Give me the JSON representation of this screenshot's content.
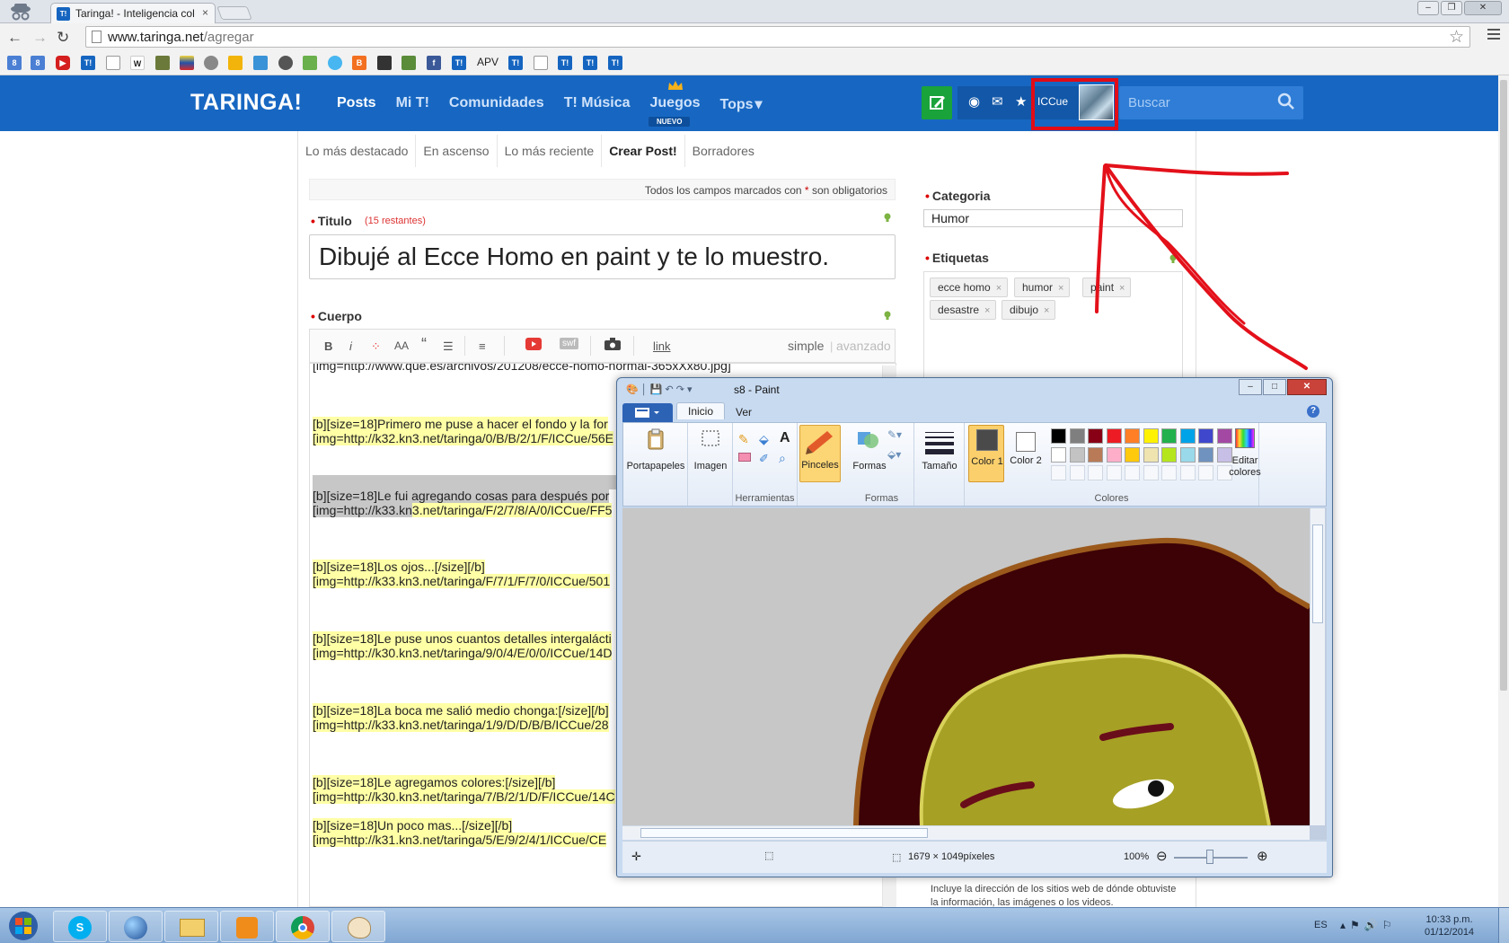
{
  "browser": {
    "tab_title": "Taringa! - Inteligencia col",
    "tab_close": "×",
    "favicon_text": "T!",
    "url_host": "www.taringa.net",
    "url_path": "/agregar",
    "bookmark_label": "APV"
  },
  "header": {
    "logo": "TARINGA!",
    "nav": [
      "Posts",
      "Mi T!",
      "Comunidades",
      "T! Música",
      "Juegos",
      "Tops"
    ],
    "nuevo_badge": "NUEVO",
    "username": "ICCue",
    "search_placeholder": "Buscar"
  },
  "subnav": [
    "Lo más destacado",
    "En ascenso",
    "Lo más reciente",
    "Crear Post!",
    "Borradores"
  ],
  "form": {
    "required_note_pre": "Todos los campos marcados con",
    "required_note_ast": "*",
    "required_note_post": "son obligatorios",
    "titulo_label": "Titulo",
    "titulo_remaining": "(15 restantes)",
    "titulo_value": "Dibujé al Ecce Homo en paint y te lo muestro.",
    "cuerpo_label": "Cuerpo",
    "toolbar": {
      "bold": "B",
      "italic": "i",
      "size": "AA",
      "quote": "“",
      "swf": "swf",
      "link": "link",
      "simple": "simple",
      "avanzado": "avanzado"
    },
    "body_lines": [
      {
        "pre": "[img=http://www.que.es/archivos/201208/ecce-homo-normal-365xXx80.jpg]",
        "hl": "",
        "sel": ""
      },
      {
        "pre": "",
        "hl": "[b][size=18]Primero me puse a hacer el fondo y la for",
        "sel": ""
      },
      {
        "pre": "",
        "hl": "[img=http://k32.kn3.net/taringa/0/B/B/2/1/F/ICCue/56E",
        "sel": ""
      },
      {
        "pre": "",
        "hl": "",
        "sel": "[b][size=18]Le fui agregando cosas para después por"
      },
      {
        "pre": "",
        "hl": "3.net/taringa/F/2/7/8/A/0/ICCue/FF5",
        "sel": "[img=http://k33.kn"
      },
      {
        "pre": "",
        "hl": "[b][size=18]Los ojos...[/size][/b]",
        "sel": ""
      },
      {
        "pre": "",
        "hl": "[img=http://k33.kn3.net/taringa/F/7/1/F/7/0/ICCue/501",
        "sel": ""
      },
      {
        "pre": "",
        "hl": "[b][size=18]Le puse unos cuantos detalles intergalácti",
        "sel": ""
      },
      {
        "pre": "",
        "hl": "[img=http://k30.kn3.net/taringa/9/0/4/E/0/0/ICCue/14D",
        "sel": ""
      },
      {
        "pre": "",
        "hl": "[b][size=18]La boca me salió medio chonga:[/size][/b]",
        "sel": ""
      },
      {
        "pre": "",
        "hl": "[img=http://k33.kn3.net/taringa/1/9/D/D/B/B/ICCue/28",
        "sel": ""
      },
      {
        "pre": "",
        "hl": "[b][size=18]Le agregamos colores:[/size][/b]",
        "sel": ""
      },
      {
        "pre": "",
        "hl": "[img=http://k30.kn3.net/taringa/7/B/2/1/D/F/ICCue/14C",
        "sel": ""
      },
      {
        "pre": "",
        "hl": "[b][size=18]Un poco mas...[/size][/b]",
        "sel": ""
      },
      {
        "pre": "",
        "hl": "[img=http://k31.kn3.net/taringa/5/E/9/2/4/1/ICCue/CE",
        "sel": ""
      }
    ],
    "categoria_label": "Categoria",
    "categoria_value": "Humor",
    "etiquetas_label": "Etiquetas",
    "tags": [
      "ecce homo",
      "humor",
      "paint",
      "desastre",
      "dibujo"
    ],
    "tag_remove": "×",
    "help_text": "Incluye la dirección de los sitios web de dónde obtuviste la información, las imágenes o los videos."
  },
  "paint": {
    "title": "s8 - Paint",
    "tabs": [
      "Inicio",
      "Ver"
    ],
    "groups": {
      "portapapeles": "Portapapeles",
      "imagen": "Imagen",
      "herramientas": "Herramientas",
      "pinceles": "Pinceles",
      "formas_btn": "Formas",
      "formas_group": "Formas",
      "tamano": "Tamaño",
      "color1": "Color 1",
      "color2": "Color 2",
      "colores": "Colores",
      "editar_colores": "Editar colores"
    },
    "palette_row1": [
      "#000000",
      "#7f7f7f",
      "#880015",
      "#ed1c24",
      "#ff7f27",
      "#fff200",
      "#22b14c",
      "#00a2e8",
      "#3f48cc",
      "#a349a4"
    ],
    "palette_row2": [
      "#ffffff",
      "#c3c3c3",
      "#b97a57",
      "#ffaec9",
      "#ffc90e",
      "#efe4b0",
      "#b5e61d",
      "#99d9ea",
      "#7092be",
      "#c8bfe7"
    ],
    "color1_hex": "#4a4a4a",
    "dimensions": "1679 × 1049píxeles",
    "zoom": "100%"
  },
  "taskbar": {
    "lang": "ES",
    "time": "10:33 p.m.",
    "date": "01/12/2014"
  }
}
